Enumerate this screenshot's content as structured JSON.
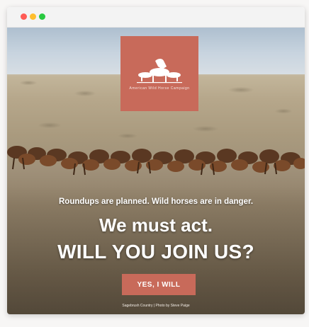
{
  "window": {
    "controls": [
      "close",
      "minimize",
      "maximize"
    ]
  },
  "logo": {
    "icon": "horses-logo-icon",
    "tagline": "American Wild Horse Campaign",
    "color": "#c86a5a"
  },
  "hero": {
    "subheadline": "Roundups are planned. Wild horses are in danger.",
    "headline": "We must act.",
    "headline_emphasis": "WILL YOU JOIN US?",
    "cta_label": "YES, I WILL",
    "credit_left": "Sagebrush Country",
    "credit_separator": "|",
    "credit_right": "Photo by Steve Paige"
  },
  "colors": {
    "accent": "#c86a5a",
    "text_on_image": "#ffffff"
  }
}
